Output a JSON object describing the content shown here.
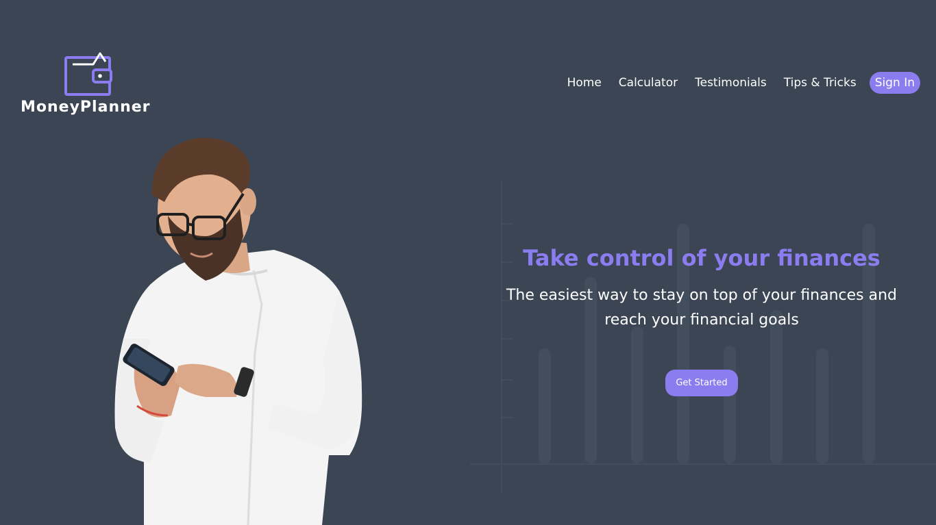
{
  "brand": {
    "name": "MoneyPlanner",
    "icon": "wallet-icon",
    "accent_color": "#8b7cf0"
  },
  "nav": {
    "links": [
      {
        "label": "Home"
      },
      {
        "label": "Calculator"
      },
      {
        "label": "Testimonials"
      },
      {
        "label": "Tips & Tricks"
      }
    ],
    "signin_label": "Sign In"
  },
  "hero": {
    "title": "Take control of your finances",
    "subtitle": "The easiest way to stay on top of your finances and reach your financial goals",
    "cta_label": "Get Started"
  },
  "colors": {
    "background": "#3b4553",
    "accent": "#8b7cf0",
    "text": "#ffffff"
  }
}
